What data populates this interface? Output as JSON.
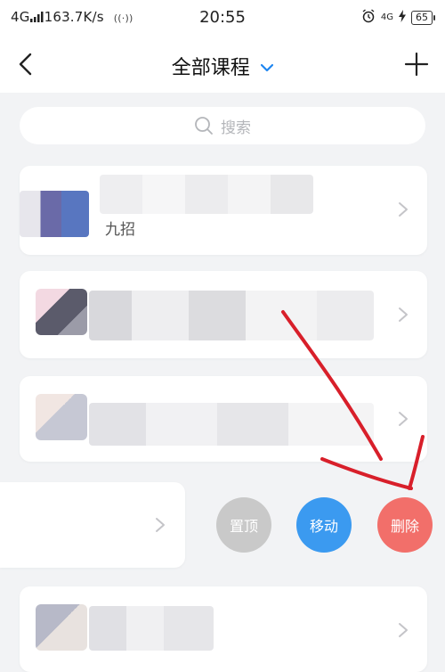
{
  "status_bar": {
    "network": "4G",
    "speed": "163.7K/s",
    "time": "20:55",
    "right_network": "4G",
    "battery": "65"
  },
  "header": {
    "title": "全部课程",
    "back_icon": "chevron-left-icon",
    "add_icon": "plus-icon"
  },
  "search": {
    "placeholder": "搜索"
  },
  "courses": [
    {
      "visible_text": "九招"
    },
    {
      "visible_text": ""
    },
    {
      "visible_text": ""
    },
    {
      "visible_text": ""
    },
    {
      "visible_text": ""
    }
  ],
  "swipe_actions": {
    "pin": "置顶",
    "move": "移动",
    "delete": "删除"
  },
  "colors": {
    "accent": "#1f86f0",
    "pin_button": "#c9c9c9",
    "move_button": "#3b9af0",
    "delete_button": "#f26f6a",
    "annotation": "#d81f2a"
  }
}
